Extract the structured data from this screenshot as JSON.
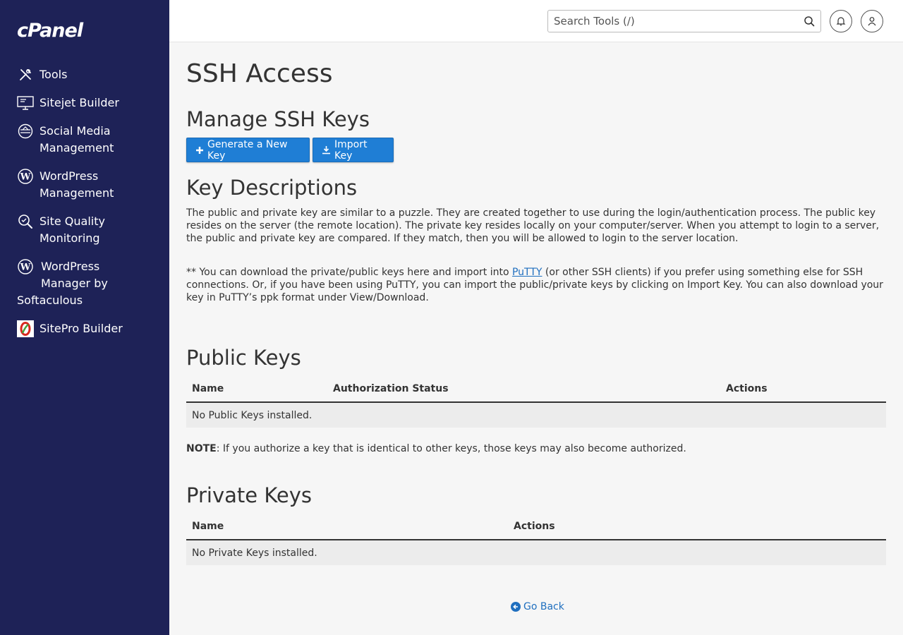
{
  "brand": {
    "logo_text": "cPanel"
  },
  "sidebar": {
    "items": [
      {
        "label": "Tools",
        "icon": "tools-icon"
      },
      {
        "label": "Sitejet Builder",
        "icon": "sitejet-icon"
      },
      {
        "label": "Social Media\nManagement",
        "icon": "social-media-icon"
      },
      {
        "label": "WordPress\nManagement",
        "icon": "wordpress-icon"
      },
      {
        "label": "Site Quality\nMonitoring",
        "icon": "site-quality-icon"
      },
      {
        "label": "WordPress\nManager by\nSoftaculous",
        "icon": "wordpress-icon"
      },
      {
        "label": "SitePro Builder",
        "icon": "sitepro-icon"
      }
    ]
  },
  "header": {
    "search_placeholder": "Search Tools (/)",
    "notifications_icon": "bell-icon",
    "user_icon": "user-icon"
  },
  "page": {
    "title": "SSH Access",
    "manage_heading": "Manage SSH Keys",
    "generate_label": "Generate a New Key",
    "import_label": "Import Key",
    "descriptions_heading": "Key Descriptions",
    "description_text": "The public and private key are similar to a puzzle. They are created together to use during the login/authentication process. The public key resides on the server (the remote location). The private key resides locally on your computer/server. When you attempt to login to a server, the public and private key are compared. If they match, then you will be allowed to login to the server location.",
    "download_text_before": "** You can download the private/public keys here and import into ",
    "putty_link": "PuTTY",
    "download_text_after": " (or other SSH clients) if you prefer using something else for SSH connections. Or, if you have been using PuTTY, you can import the public/private keys by clicking on Import Key. You can also download your key in PuTTY’s ppk format under View/Download.",
    "public_heading": "Public Keys",
    "public_columns": [
      "Name",
      "Authorization Status",
      "Actions"
    ],
    "public_empty": "No Public Keys installed.",
    "note_label": "NOTE",
    "note_text": ": If you authorize a key that is identical to other keys, those keys may also become authorized.",
    "private_heading": "Private Keys",
    "private_columns": [
      "Name",
      "Actions"
    ],
    "private_empty": "No Private Keys installed.",
    "go_back": "Go Back"
  },
  "colors": {
    "sidebar_bg": "#1e2257",
    "accent": "#1f7ed5",
    "link": "#1f6fbf"
  }
}
